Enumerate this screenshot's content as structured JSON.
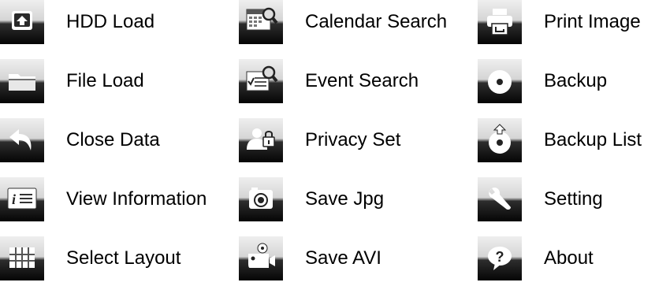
{
  "menu": {
    "items": [
      {
        "label": "HDD Load",
        "icon": "hdd-load-icon"
      },
      {
        "label": "Calendar Search",
        "icon": "calendar-search-icon"
      },
      {
        "label": "Print Image",
        "icon": "printer-icon"
      },
      {
        "label": "File Load",
        "icon": "folder-icon"
      },
      {
        "label": "Event Search",
        "icon": "event-search-icon"
      },
      {
        "label": "Backup",
        "icon": "disc-icon"
      },
      {
        "label": "Close Data",
        "icon": "back-arrow-icon"
      },
      {
        "label": "Privacy Set",
        "icon": "privacy-lock-icon"
      },
      {
        "label": "Backup List",
        "icon": "disc-upload-icon"
      },
      {
        "label": "View Information",
        "icon": "info-list-icon"
      },
      {
        "label": "Save Jpg",
        "icon": "camera-icon"
      },
      {
        "label": "Setting",
        "icon": "wrench-icon"
      },
      {
        "label": "Select Layout",
        "icon": "grid-layout-icon"
      },
      {
        "label": "Save AVI",
        "icon": "video-camera-icon"
      },
      {
        "label": "About",
        "icon": "help-bubble-icon"
      }
    ]
  }
}
